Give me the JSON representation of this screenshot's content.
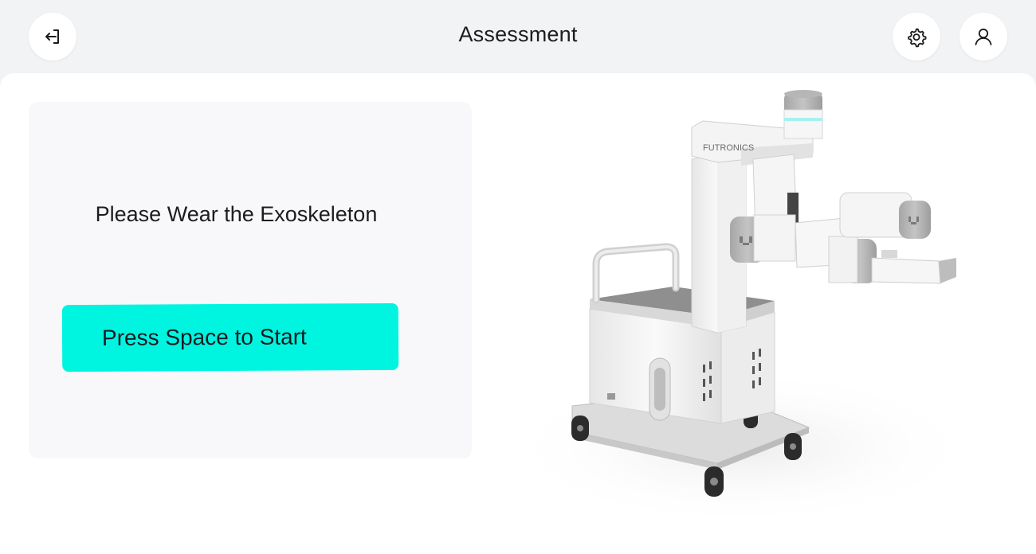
{
  "header": {
    "title": "Assessment",
    "logout_icon": "logout-icon",
    "settings_icon": "gear-icon",
    "profile_icon": "user-icon"
  },
  "main": {
    "instruction": "Please Wear the Exoskeleton",
    "start_button_label": "Press Space to Start",
    "device_brand": "FUTRONICS"
  },
  "colors": {
    "accent": "#00f5e1",
    "page_background": "#f2f3f5",
    "panel_background": "#f8f8fa"
  }
}
